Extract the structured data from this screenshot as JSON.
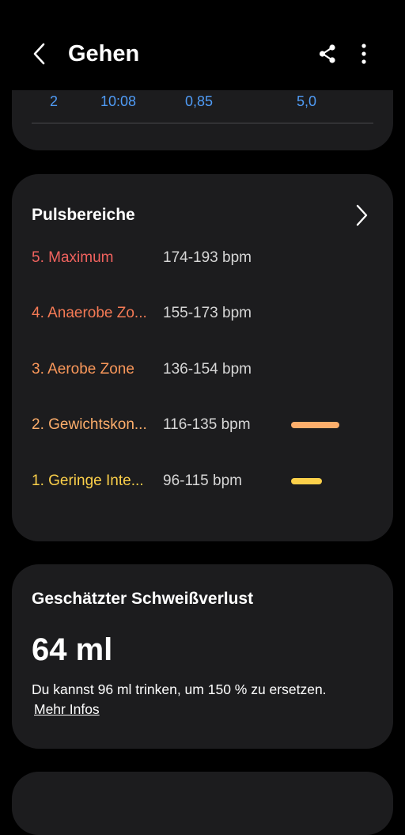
{
  "header": {
    "title": "Gehen"
  },
  "laps": {
    "row": {
      "lap": "2",
      "time": "10:08",
      "distance": "0,85",
      "pace": "5,0"
    }
  },
  "zones": {
    "title": "Pulsbereiche",
    "items": [
      {
        "name": "5. Maximum",
        "range": "174-193 bpm",
        "color": "#f0625e",
        "fraction": 0
      },
      {
        "name": "4. Anaerobe Zo...",
        "range": "155-173 bpm",
        "color": "#f57a55",
        "fraction": 0
      },
      {
        "name": "3. Aerobe Zone",
        "range": "136-154 bpm",
        "color": "#f9975a",
        "fraction": 0
      },
      {
        "name": "2. Gewichtskon...",
        "range": "116-135 bpm",
        "color": "#fdae6b",
        "fraction": 0.66
      },
      {
        "name": "1. Geringe Inte...",
        "range": "96-115 bpm",
        "color": "#fcd04a",
        "fraction": 0.42
      }
    ]
  },
  "sweat": {
    "title": "Geschätzter Schweißverlust",
    "value": "64 ml",
    "description": "Du kannst 96 ml trinken, um 150 % zu ersetzen.",
    "link": "Mehr Infos"
  },
  "icons": {
    "back": "chevron-left-icon",
    "share": "share-icon",
    "more": "more-vertical-icon",
    "zones_open": "chevron-right-icon"
  }
}
